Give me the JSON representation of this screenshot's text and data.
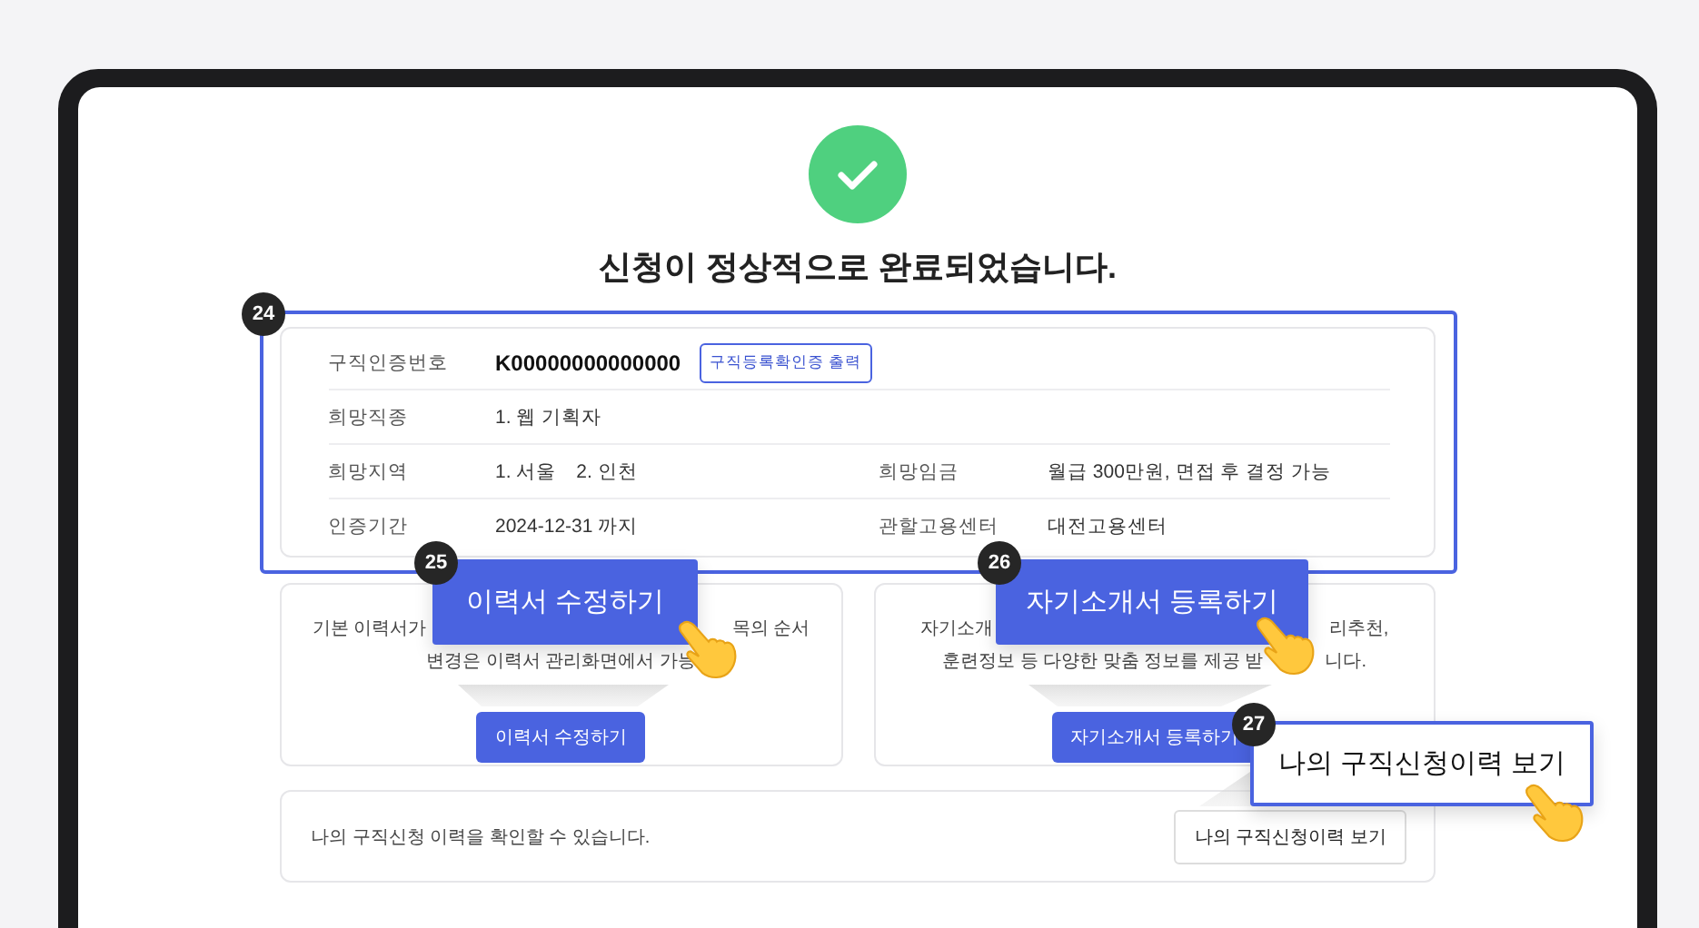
{
  "title": "신청이 정상적으로 완료되었습니다.",
  "highlight": {
    "number": "24"
  },
  "info_rows": [
    {
      "fields": [
        {
          "label": "구직인증번호",
          "value": "K00000000000000",
          "emphasis": true,
          "button": "구직등록확인증 출력"
        }
      ]
    },
    {
      "fields": [
        {
          "label": "희망직종",
          "value": "1. 웹 기획자",
          "emphasis": false
        }
      ]
    },
    {
      "fields": [
        {
          "label": "희망지역",
          "value": "1. 서울　2. 인천",
          "emphasis": false
        },
        {
          "label": "희망임금",
          "value": "월급 300만원, 면접 후 결정 가능",
          "emphasis": false
        }
      ]
    },
    {
      "fields": [
        {
          "label": "인증기간",
          "value": "2024-12-31 까지",
          "emphasis": false
        },
        {
          "label": "관할고용센터",
          "value": "대전고용센터",
          "emphasis": false
        }
      ]
    }
  ],
  "cards": [
    {
      "lines": [
        [
          "기본 이력서가",
          "목의 순서"
        ],
        [
          "변경은 이력서 관리화면에서 가능"
        ]
      ],
      "button": "이력서 수정하기"
    },
    {
      "lines": [
        [
          "자기소개",
          "리추천,"
        ],
        [
          "훈련정보 등 다양한 맞춤 정보를 제공 받",
          "니다."
        ]
      ],
      "button": "자기소개서 등록하기"
    }
  ],
  "history": {
    "text": "나의 구직신청 이력을 확인할 수 있습니다.",
    "button": "나의 구직신청이력 보기"
  },
  "callouts": [
    {
      "number": "25",
      "label": "이력서 수정하기",
      "kind": "filled"
    },
    {
      "number": "26",
      "label": "자기소개서 등록하기",
      "kind": "filled"
    },
    {
      "number": "27",
      "label": "나의 구직신청이력 보기",
      "kind": "outlined"
    }
  ]
}
